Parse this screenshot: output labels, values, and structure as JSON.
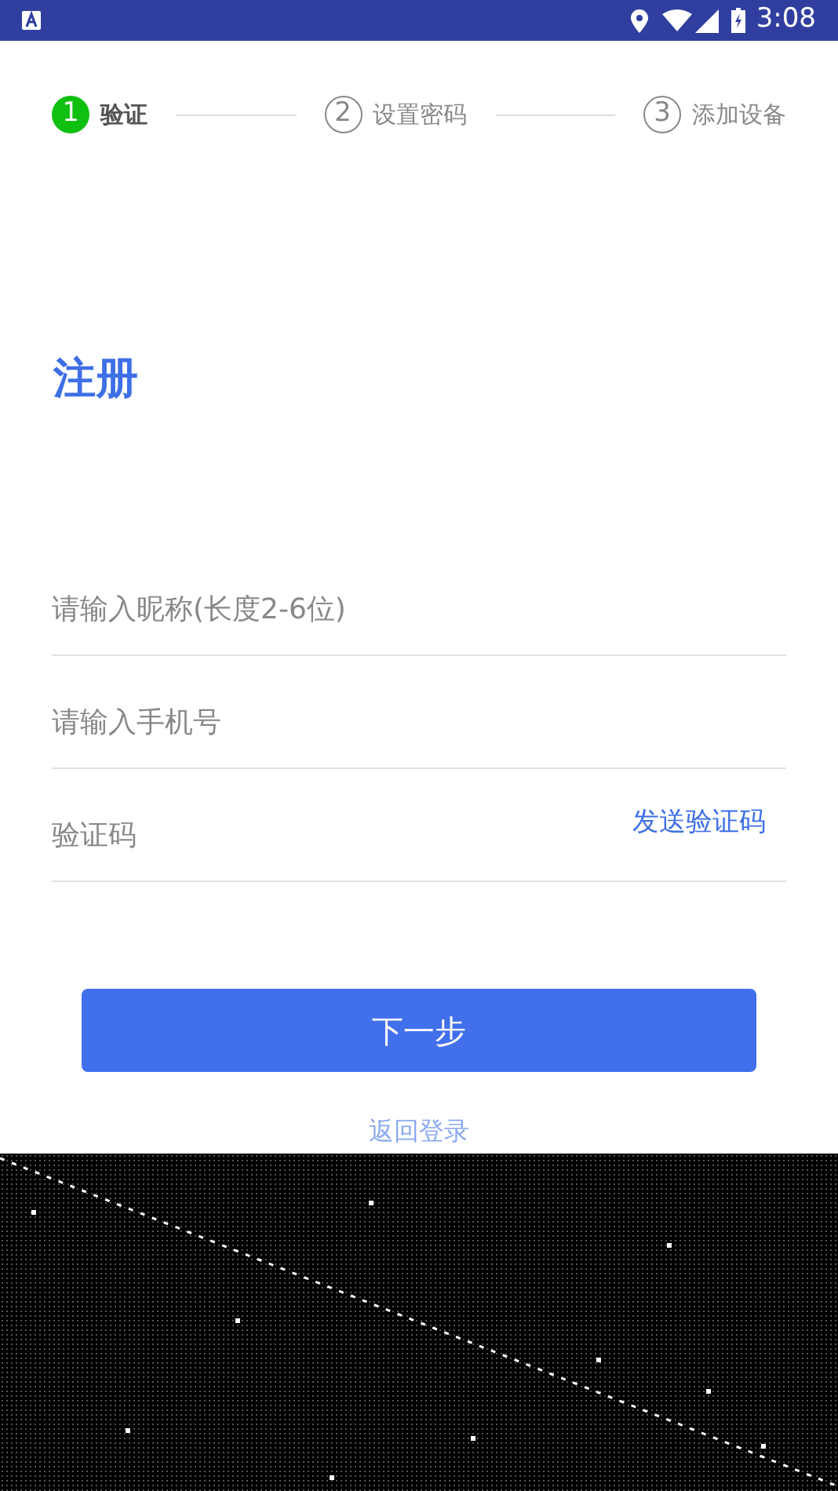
{
  "status_bar": {
    "time": "3:08"
  },
  "steps": [
    {
      "number": "1",
      "label": "验证",
      "selected": true
    },
    {
      "number": "2",
      "label": "设置密码",
      "selected": false
    },
    {
      "number": "3",
      "label": "添加设备",
      "selected": false
    }
  ],
  "title": "注册",
  "fields": [
    {
      "kind": "text",
      "placeholder": "请输入昵称(长度2-6位)"
    },
    {
      "kind": "text",
      "placeholder": "请输入手机号"
    },
    {
      "kind": "code",
      "placeholder": "验证码",
      "action": "发送验证码"
    }
  ],
  "next_button": "下一步",
  "back_link": "返回登录"
}
